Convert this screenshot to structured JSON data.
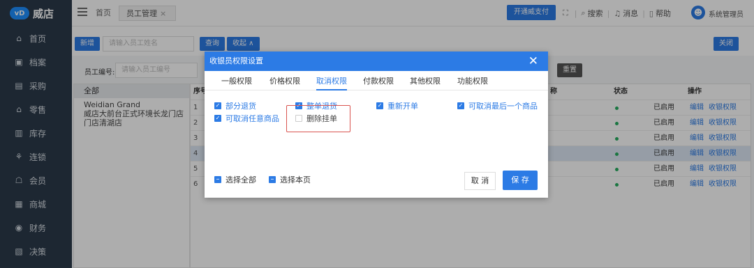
{
  "app": {
    "logo_mark": "vD",
    "logo_text": "威店"
  },
  "tabs": {
    "home": "首页",
    "active": "员工管理",
    "close": "×"
  },
  "header": {
    "pay_button": "开通威支付",
    "search": "搜索",
    "messages": "消息",
    "help": "帮助",
    "user": "系统管理员",
    "icons": [
      "fullscreen-icon",
      "search-icon",
      "bell-icon",
      "help-icon",
      "user-icon"
    ]
  },
  "sidebar": {
    "items": [
      {
        "label": "首页",
        "icon": "home-icon",
        "glyph": "⌂"
      },
      {
        "label": "档案",
        "icon": "archive-icon",
        "glyph": "▣"
      },
      {
        "label": "采购",
        "icon": "purchase-icon",
        "glyph": "▤"
      },
      {
        "label": "零售",
        "icon": "retail-icon",
        "glyph": "⌂"
      },
      {
        "label": "库存",
        "icon": "inventory-icon",
        "glyph": "▥"
      },
      {
        "label": "连锁",
        "icon": "chain-icon",
        "glyph": "⚘"
      },
      {
        "label": "会员",
        "icon": "member-icon",
        "glyph": "☖"
      },
      {
        "label": "商城",
        "icon": "mall-icon",
        "glyph": "▦"
      },
      {
        "label": "财务",
        "icon": "finance-icon",
        "glyph": "◉"
      },
      {
        "label": "决策",
        "icon": "decision-icon",
        "glyph": "▧"
      }
    ]
  },
  "toolbar": {
    "add_button": "新增",
    "name_placeholder": "请输入员工姓名",
    "query_button": "查询",
    "collapse_button": "收起 ∧",
    "close_button": "关闭",
    "emp_no_label": "员工编号:",
    "emp_no_placeholder": "请输入员工编号",
    "reset_button": "重置"
  },
  "tree": {
    "header": "全部",
    "items": [
      "Weidian Grand",
      "威店大前台正式环境长龙门店",
      "门店清湖店"
    ]
  },
  "table": {
    "headers": {
      "index": "序号",
      "col_partial": "称",
      "status": "状态",
      "actions": "操作"
    },
    "rows": [
      {
        "idx": "1",
        "status": "已启用",
        "edit": "编辑",
        "perm": "收银权限"
      },
      {
        "idx": "2",
        "status": "已启用",
        "edit": "编辑",
        "perm": "收银权限"
      },
      {
        "idx": "3",
        "status": "已启用",
        "edit": "编辑",
        "perm": "收银权限"
      },
      {
        "idx": "4",
        "status": "已启用",
        "edit": "编辑",
        "perm": "收银权限"
      },
      {
        "idx": "5",
        "status": "已启用",
        "edit": "编辑",
        "perm": "收银权限"
      },
      {
        "idx": "6",
        "status": "已启用",
        "edit": "编辑",
        "perm": "收银权限"
      }
    ],
    "selected_row": 4
  },
  "modal": {
    "title": "收银员权限设置",
    "close": "✕",
    "tabs": [
      "一般权限",
      "价格权限",
      "取消权限",
      "付款权限",
      "其他权限",
      "功能权限"
    ],
    "active_tab": "取消权限",
    "options": [
      {
        "label": "部分退货",
        "checked": true
      },
      {
        "label": "整单退货",
        "checked": true
      },
      {
        "label": "重新开单",
        "checked": true
      },
      {
        "label": "可取消最后一个商品",
        "checked": true
      },
      {
        "label": "可取消任意商品",
        "checked": true
      },
      {
        "label": "删除挂单",
        "checked": false
      }
    ],
    "select_all": "选择全部",
    "select_page": "选择本页",
    "cancel_button": "取 消",
    "save_button": "保 存"
  },
  "colors": {
    "primary": "#2c7be5",
    "sidebar": "#2b3a4a",
    "highlight_frame": "#d9534f",
    "status_dot": "#27ae60"
  }
}
